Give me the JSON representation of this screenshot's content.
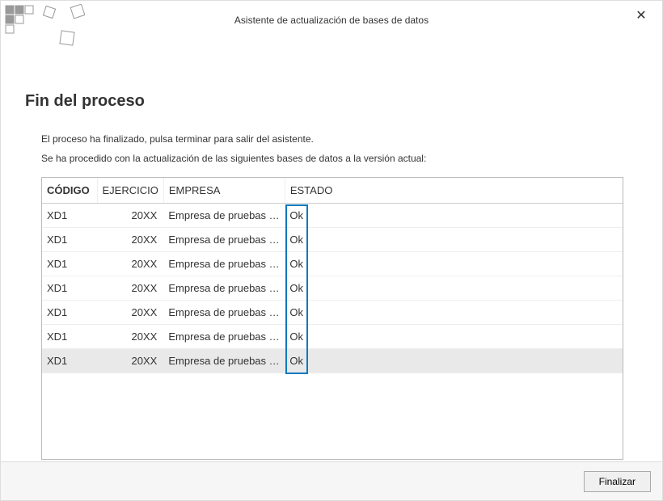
{
  "window": {
    "title": "Asistente de actualización de bases de datos"
  },
  "page": {
    "heading": "Fin del proceso",
    "message1": "El proceso ha finalizado, pulsa terminar para salir del asistente.",
    "message2": "Se ha procedido con la actualización de las siguientes bases de datos a la versión actual:"
  },
  "table": {
    "headers": {
      "codigo": "CÓDIGO",
      "ejercicio": "EJERCICIO",
      "empresa": "EMPRESA",
      "estado": "ESTADO"
    },
    "rows": [
      {
        "codigo": "XD1",
        "ejercicio": "20XX",
        "empresa": "Empresa de pruebas de F...",
        "estado": "Ok"
      },
      {
        "codigo": "XD1",
        "ejercicio": "20XX",
        "empresa": "Empresa de pruebas de F...",
        "estado": "Ok"
      },
      {
        "codigo": "XD1",
        "ejercicio": "20XX",
        "empresa": "Empresa de pruebas de F...",
        "estado": "Ok"
      },
      {
        "codigo": "XD1",
        "ejercicio": "20XX",
        "empresa": "Empresa de pruebas de F...",
        "estado": "Ok"
      },
      {
        "codigo": "XD1",
        "ejercicio": "20XX",
        "empresa": "Empresa de pruebas de F...",
        "estado": "Ok"
      },
      {
        "codigo": "XD1",
        "ejercicio": "20XX",
        "empresa": "Empresa de pruebas de F...",
        "estado": "Ok"
      },
      {
        "codigo": "XD1",
        "ejercicio": "20XX",
        "empresa": "Empresa de pruebas de F...",
        "estado": "Ok",
        "selected": true
      }
    ]
  },
  "footer": {
    "finish_label": "Finalizar"
  }
}
